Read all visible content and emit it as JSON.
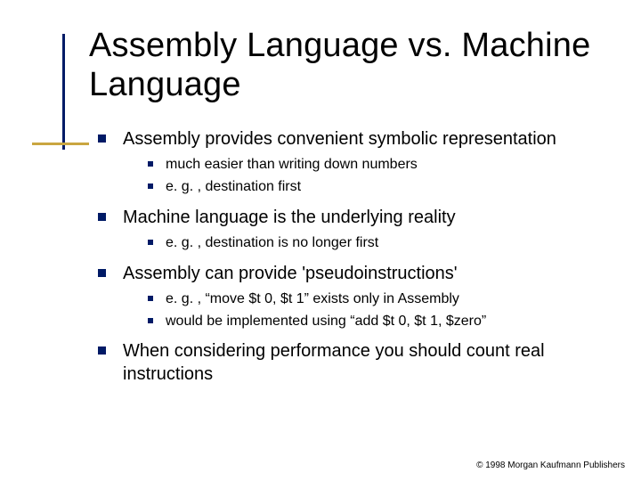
{
  "title": "Assembly Language vs. Machine Language",
  "bullets": [
    {
      "text": "Assembly provides convenient symbolic representation",
      "sub": [
        "much easier than writing down numbers",
        "e. g. , destination first"
      ]
    },
    {
      "text": "Machine language is the underlying reality",
      "sub": [
        "e. g. , destination is no longer first"
      ]
    },
    {
      "text": "Assembly can provide 'pseudoinstructions'",
      "sub": [
        "e. g. , “move $t 0, $t 1” exists only in Assembly",
        "would be implemented using “add $t 0, $t 1, $zero”"
      ]
    },
    {
      "text": "When considering performance you should count real instructions",
      "sub": []
    }
  ],
  "footer": "© 1998 Morgan Kaufmann Publishers"
}
